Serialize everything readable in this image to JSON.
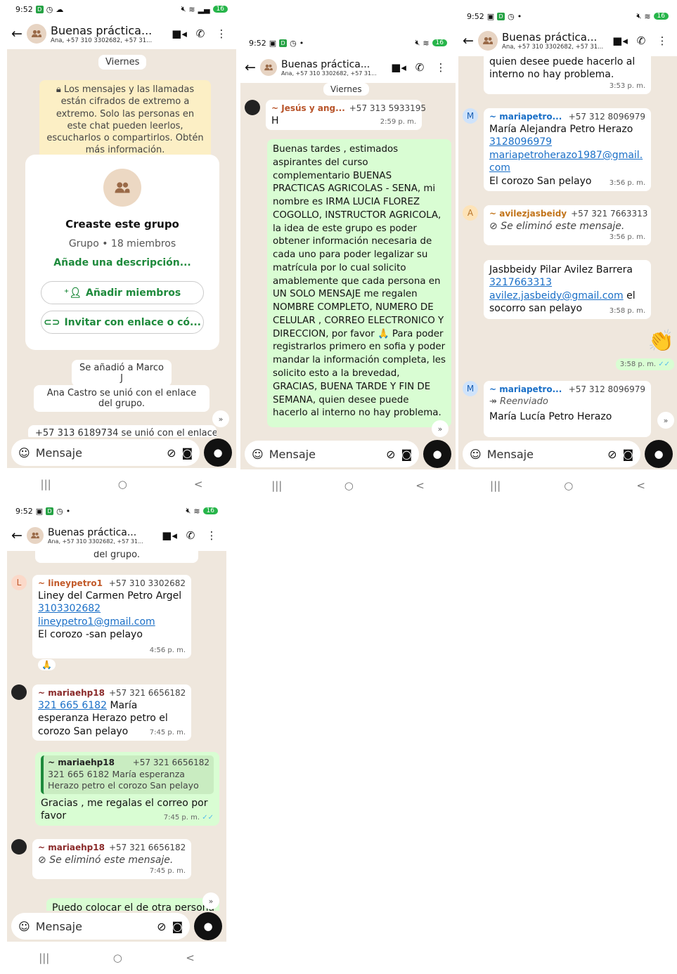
{
  "status": {
    "time": "9:52",
    "battery": "16"
  },
  "header": {
    "title": "Buenas práctica...",
    "subtitle": "Ana, +57 310 3302682, +57 31..."
  },
  "input": {
    "placeholder": "Mensaje"
  },
  "p1": {
    "date": "Viernes",
    "e2e": "Los mensajes y las llamadas están cifrados de extremo a extremo. Solo las personas en este chat pueden leerlos, escucharlos o compartirlos. Obtén más información.",
    "created": "Creaste este grupo",
    "group_info": "Grupo • 18 miembros",
    "add_desc": "Añade una descripción...",
    "add_members": "Añadir miembros",
    "invite": "Invitar con enlace o có...",
    "sys1": "Se añadió a Marco J",
    "sys2": "Ana Castro se unió con el enlace del grupo.",
    "sys3": "+57 313 6189734 se unió con el enlace"
  },
  "p2": {
    "date": "Viernes",
    "m1": {
      "name": "~ Jesús y ang...",
      "phone": "+57 313 5933195",
      "text": "H",
      "time": "2:59 p. m."
    },
    "m2": {
      "text": "Buenas tardes , estimados aspirantes del curso complementario BUENAS PRACTICAS AGRICOLAS - SENA, mi nombre es IRMA LUCIA FLOREZ COGOLLO, INSTRUCTOR AGRICOLA, la idea de este grupo es poder obtener información necesaria de cada uno para poder legalizar su matrícula por lo cual solicito amablemente que cada persona en UN SOLO MENSAJE me regalen NOMBRE COMPLETO, NUMERO DE CELULAR , CORREO ELECTRONICO Y DIRECCION, por favor 🙏 Para poder registrarlos primero en sofia y poder mandar la información completa, les solicito esto a la brevedad, GRACIAS, BUENA TARDE Y FIN DE SEMANA, quien desee puede hacerlo al interno no hay problema."
    }
  },
  "p3": {
    "m0": {
      "text": "quien desee puede hacerlo al interno no hay problema.",
      "time": "3:53 p. m."
    },
    "m1": {
      "name": "~ mariapetro...",
      "phone": "+57 312 8096979",
      "line1": "María Alejandra Petro Herazo",
      "link1": "3128096979",
      "link2": "mariapetroherazo1987@gmail.com",
      "line2": "El corozo San pelayo",
      "time": "3:56 p. m."
    },
    "m2": {
      "name": "~ avilezjasbeidy",
      "phone": "+57 321 7663313",
      "text": "Se eliminó este mensaje.",
      "time": "3:56 p. m."
    },
    "m3": {
      "line1": "Jasbbeidy Pilar Avilez Barrera",
      "link1": "3217663313",
      "link2": "avilez.jasbeidy@gmail.com",
      "tail": "el",
      "line2": "socorro  san pelayo",
      "time": "3:58 p. m."
    },
    "m4": {
      "emoji": "👏",
      "time": "3:58 p. m."
    },
    "m5": {
      "name": "~ mariapetro...",
      "phone": "+57 312 8096979",
      "fwd": "Reenviado",
      "text": "María Lucía Petro Herazo"
    }
  },
  "p4": {
    "top": "del grupo.",
    "m1": {
      "name": "~ lineypetro1",
      "phone": "+57 310 3302682",
      "line1": "Liney del Carmen Petro Argel",
      "link1": "3103302682",
      "link2": "lineypetro1@gmail.com",
      "line2": "El corozo -san pelayo",
      "time": "4:56 p. m.",
      "react": "🙏"
    },
    "m2": {
      "name": "~ mariaehp18",
      "phone": "+57 321 6656182",
      "link": "321 665 6182",
      "text": "María esperanza Herazo petro el corozo San pelayo",
      "time": "7:45 p. m."
    },
    "m3": {
      "qname": "~ mariaehp18",
      "qphone": "+57 321 6656182",
      "quote": "321 665 6182 María esperanza Herazo petro el corozo San pelayo",
      "text": "Gracias , me regalas el correo por favor",
      "time": "7:45 p. m."
    },
    "m4": {
      "name": "~ mariaehp18",
      "phone": "+57 321 6656182",
      "text": "Se eliminó este mensaje.",
      "time": "7:45 p. m."
    },
    "m5": {
      "text": "Puedo colocar el de otra persona"
    }
  },
  "colors": {
    "outgoing": "#d9fdd3",
    "wallpaper": "#efe7dd",
    "link": "#1a6fc7",
    "green": "#1e8a3c"
  }
}
